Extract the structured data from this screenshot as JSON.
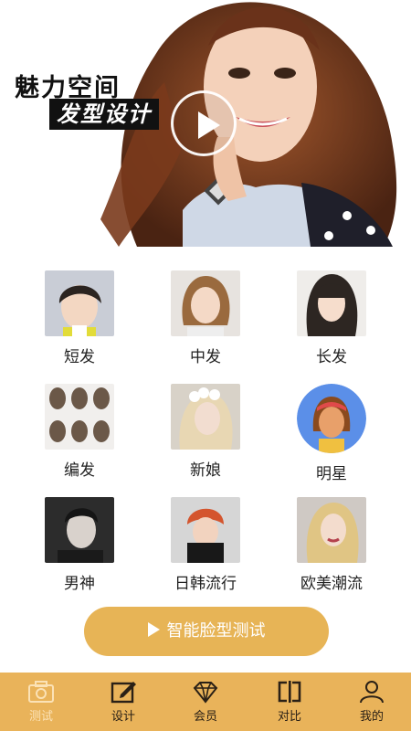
{
  "banner": {
    "title": "魅力空间",
    "subtitle": "发型设计"
  },
  "categories": [
    {
      "label": "短发",
      "icon": "short-hair-photo"
    },
    {
      "label": "中发",
      "icon": "medium-hair-photo"
    },
    {
      "label": "长发",
      "icon": "long-hair-photo"
    },
    {
      "label": "编发",
      "icon": "braid-photo"
    },
    {
      "label": "新娘",
      "icon": "bride-photo"
    },
    {
      "label": "明星",
      "icon": "star-avatar"
    },
    {
      "label": "男神",
      "icon": "men-photo"
    },
    {
      "label": "日韩流行",
      "icon": "asian-trend-photo"
    },
    {
      "label": "欧美潮流",
      "icon": "western-trend-photo"
    }
  ],
  "cta": {
    "label": "智能脸型测试"
  },
  "tabs": [
    {
      "label": "测试",
      "icon": "camera-icon",
      "active": true
    },
    {
      "label": "设计",
      "icon": "edit-icon",
      "active": false
    },
    {
      "label": "会员",
      "icon": "diamond-icon",
      "active": false
    },
    {
      "label": "对比",
      "icon": "compare-icon",
      "active": false
    },
    {
      "label": "我的",
      "icon": "person-icon",
      "active": false
    }
  ],
  "colors": {
    "accent": "#e7b456",
    "tabbar": "#e9b35a",
    "active_tab": "#fbe2b6"
  }
}
